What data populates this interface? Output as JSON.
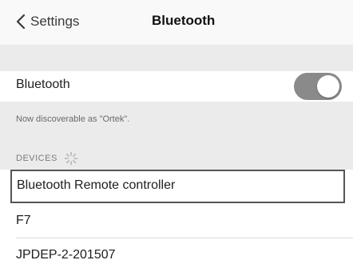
{
  "nav": {
    "back_label": "Settings",
    "title": "Bluetooth"
  },
  "bluetooth_row": {
    "label": "Bluetooth",
    "toggle_on": true,
    "toggle_color": "#8a8a8a"
  },
  "discoverable_note": "Now discoverable as \"Ortek\".",
  "devices_section": {
    "header": "DEVICES",
    "spinner_icon": "spinner-icon",
    "items": [
      {
        "label": "Bluetooth Remote controller",
        "highlighted": true
      },
      {
        "label": "F7",
        "highlighted": false
      },
      {
        "label": "JPDEP-2-201507",
        "highlighted": false
      }
    ]
  }
}
